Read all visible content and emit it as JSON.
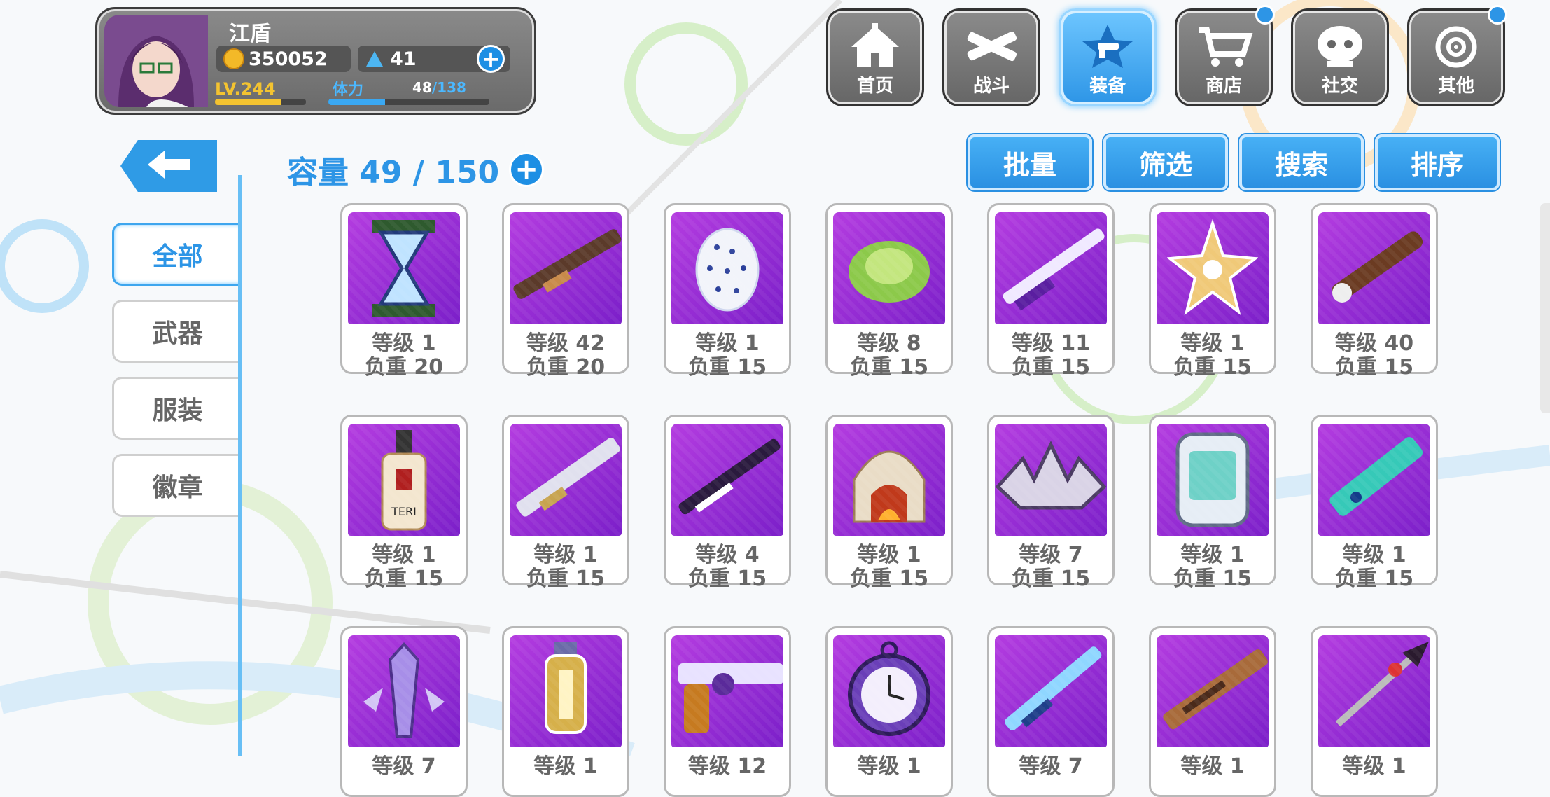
{
  "player": {
    "name": "江盾",
    "gold": "350052",
    "gems": "41",
    "level": "LV.244",
    "level_progress": 0.72,
    "stamina_label": "体力",
    "stamina_current": "48",
    "stamina_max": "/138",
    "stamina_progress": 0.35
  },
  "nav": [
    {
      "label": "首页",
      "icon": "house-icon"
    },
    {
      "label": "战斗",
      "icon": "crossed-guns-icon"
    },
    {
      "label": "装备",
      "icon": "star-gun-icon",
      "active": true
    },
    {
      "label": "商店",
      "icon": "cart-icon",
      "badge": true
    },
    {
      "label": "社交",
      "icon": "character-face-icon"
    },
    {
      "label": "其他",
      "icon": "target-icon",
      "badge": true
    }
  ],
  "capacity": {
    "label": "容量 49 / 150"
  },
  "actions": {
    "batch": "批量",
    "filter": "筛选",
    "search": "搜索",
    "sort": "排序"
  },
  "sidebar": {
    "all": "全部",
    "weapons": "武器",
    "clothing": "服装",
    "badges": "徽章"
  },
  "items": [
    {
      "level": "等级 1",
      "weight": "负重 20",
      "icon": "hourglass-icon"
    },
    {
      "level": "等级 42",
      "weight": "负重 20",
      "icon": "rifle-icon"
    },
    {
      "level": "等级 1",
      "weight": "负重 15",
      "icon": "egg-icon"
    },
    {
      "level": "等级 8",
      "weight": "负重 15",
      "icon": "cabbage-icon"
    },
    {
      "level": "等级 11",
      "weight": "负重 15",
      "icon": "shotgun-icon"
    },
    {
      "level": "等级 1",
      "weight": "负重 15",
      "icon": "star-badge-icon"
    },
    {
      "level": "等级 40",
      "weight": "负重 15",
      "icon": "spiked-club-icon"
    },
    {
      "level": "等级 1",
      "weight": "负重 15",
      "icon": "bottle-icon"
    },
    {
      "level": "等级 1",
      "weight": "负重 15",
      "icon": "silver-rifle-icon"
    },
    {
      "level": "等级 4",
      "weight": "负重 15",
      "icon": "dark-rifle-icon"
    },
    {
      "level": "等级 1",
      "weight": "负重 15",
      "icon": "oven-icon"
    },
    {
      "level": "等级 7",
      "weight": "负重 15",
      "icon": "tiara-icon"
    },
    {
      "level": "等级 1",
      "weight": "负重 15",
      "icon": "device-icon"
    },
    {
      "level": "等级 1",
      "weight": "负重 15",
      "icon": "teal-blade-icon"
    },
    {
      "level": "等级 7",
      "weight": "",
      "icon": "crystal-icon"
    },
    {
      "level": "等级 1",
      "weight": "",
      "icon": "lantern-icon"
    },
    {
      "level": "等级 12",
      "weight": "",
      "icon": "revolver-icon"
    },
    {
      "level": "等级 1",
      "weight": "",
      "icon": "pocket-watch-icon"
    },
    {
      "level": "等级 7",
      "weight": "",
      "icon": "ice-rifle-icon"
    },
    {
      "level": "等级 1",
      "weight": "",
      "icon": "camo-rifle-icon"
    },
    {
      "level": "等级 1",
      "weight": "",
      "icon": "spear-icon"
    }
  ]
}
